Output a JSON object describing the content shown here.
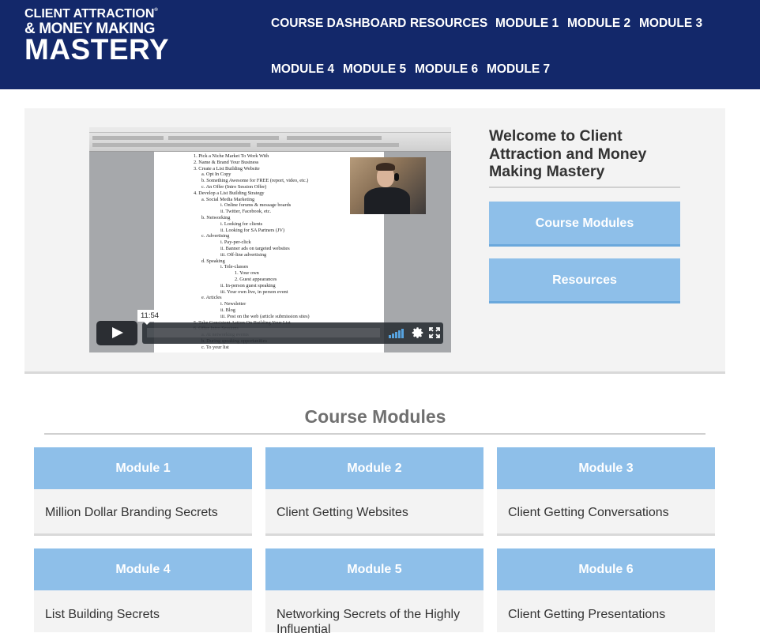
{
  "header": {
    "logo": {
      "line1": "CLIENT ATTRACTION",
      "trademark": "®",
      "line2": "& MONEY MAKING",
      "line3": "MASTERY"
    },
    "nav": [
      "COURSE DASHBOARD",
      "RESOURCES",
      "MODULE 1",
      "MODULE 2",
      "MODULE 3",
      "MODULE 4",
      "MODULE 5",
      "MODULE 6",
      "MODULE 7"
    ]
  },
  "hero": {
    "video": {
      "timecode": "11:54",
      "icons": {
        "play": "play-icon",
        "volume": "volume-icon",
        "settings": "gear-icon",
        "fullscreen": "fullscreen-icon"
      },
      "document_lines": [
        "1.  Pick a Niche Market To Work With",
        "2.  Name & Brand Your Business",
        "3.  Create a List Building Website",
        "a.  Opt In Copy",
        "b.  Something Awesome for FREE (report, video, etc.)",
        "c.  An Offer (Intro Session Offer)",
        "4.  Develop a List Building Strategy",
        "a.  Social Media Marketing",
        "i.   Online forums & message boards",
        "ii.  Twitter, Facebook, etc.",
        "b.  Networking",
        "i.   Looking for clients",
        "ii.  Looking for SA Partners (JV)",
        "c.  Advertising",
        "i.   Pay-per-click",
        "ii.  Banner ads on targeted websites",
        "iii. Off-line advertising",
        "d.  Speaking",
        "i.   Tele-classes",
        "1.  Your own",
        "2.  Guest appearances",
        "ii.  In-person guest speaking",
        "iii. Your own live, in person event",
        "e.  Articles",
        "i.   Newsletter",
        "ii.  Blog",
        "iii. Post on the web (article submission sites)",
        "5.  Take Consistent Action On Building Your List",
        "6.  Offer Intro Sessions",
        "a.  At networking events",
        "b.  During speaking opportunities",
        "c.  To your list"
      ]
    },
    "welcome_title": "Welcome to Client Attraction and Money Making Mastery",
    "buttons": [
      "Course Modules",
      "Resources"
    ]
  },
  "modules_section": {
    "title": "Course Modules",
    "cards": [
      {
        "label": "Module 1",
        "title": "Million Dollar Branding Secrets"
      },
      {
        "label": "Module 2",
        "title": "Client Getting Websites"
      },
      {
        "label": "Module 3",
        "title": "Client Getting Conversations"
      },
      {
        "label": "Module 4",
        "title": "List Building Secrets"
      },
      {
        "label": "Module 5",
        "title": "Networking Secrets of the Highly Influential"
      },
      {
        "label": "Module 6",
        "title": "Client Getting Presentations"
      }
    ]
  },
  "colors": {
    "header_bg": "#13286a",
    "accent_blue": "#8ebfe9",
    "panel_bg": "#f3f3f3",
    "text_dark": "#333333",
    "section_title": "#707070"
  }
}
